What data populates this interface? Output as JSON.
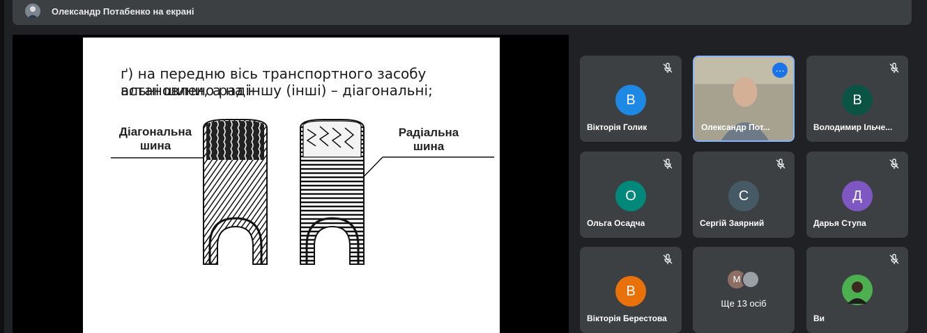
{
  "header": {
    "presenter_text": "Олександр Потабенко на екрані"
  },
  "slide": {
    "line1": "ґ) на передню вісь транспортного засобу встановлено раді-",
    "line2": "альні шини, а на іншу (інші) – діагональні;",
    "left_label_1": "Діагональна",
    "left_label_2": "шина",
    "right_label_1": "Радіальна",
    "right_label_2": "шина"
  },
  "participants": [
    {
      "name": "Вікторія Голик",
      "initial": "B",
      "color": "#1e88e5",
      "muted": true
    },
    {
      "name": "Олександр Пот...",
      "video": true,
      "selected": true
    },
    {
      "name": "Володимир Ільче...",
      "initial": "B",
      "color": "#0b5345",
      "muted": true
    },
    {
      "name": "Ольга Осадча",
      "initial": "O",
      "color": "#00897b",
      "muted": true
    },
    {
      "name": "Сергій Заярний",
      "initial": "C",
      "color": "#455a64",
      "muted": true
    },
    {
      "name": "Дарья Ступа",
      "initial": "Д",
      "color": "#7e57c2",
      "muted": true
    },
    {
      "name": "Вікторія Берестова",
      "initial": "B",
      "color": "#e8710a",
      "muted": true
    },
    {
      "more_label": "Ще 13 осіб",
      "mini_initial": "M"
    },
    {
      "name": "Ви",
      "muted": true
    }
  ]
}
